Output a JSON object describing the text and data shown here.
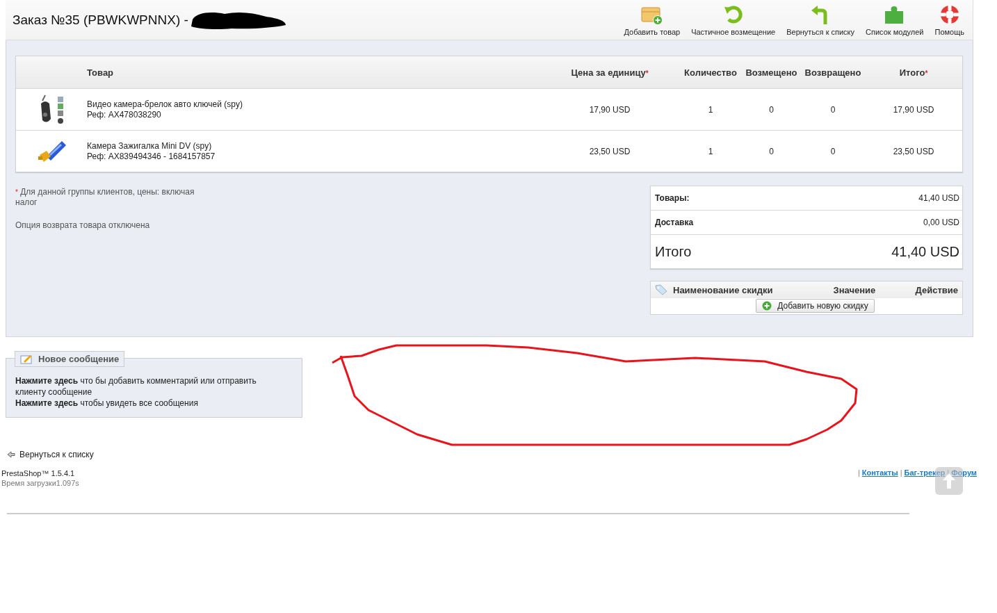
{
  "header": {
    "title": "Заказ №35 (PBWKWPNNX) -",
    "toolbar": [
      {
        "label": "Добавить товар",
        "kind": "add"
      },
      {
        "label": "Частичное возмещение",
        "kind": "refund"
      },
      {
        "label": "Вернуться к списку",
        "kind": "back"
      },
      {
        "label": "Список модулей",
        "kind": "modules"
      },
      {
        "label": "Помощь",
        "kind": "help"
      }
    ]
  },
  "products": {
    "columns": [
      {
        "label": "Товар"
      },
      {
        "label": "Цена за единицу",
        "mark": "*"
      },
      {
        "label": "Количество"
      },
      {
        "label": "Возмещено"
      },
      {
        "label": "Возвращено"
      },
      {
        "label": "Итого",
        "mark": "*"
      }
    ],
    "rows": [
      {
        "kind": "keyfob",
        "name": "Видео камера-брелок авто ключей (spy)",
        "ref": "Реф: AX478038290",
        "unit_price": "17,90 USD",
        "quantity": "1",
        "refunded": "0",
        "returned": "0",
        "total": "17,90 USD"
      },
      {
        "kind": "lighter",
        "name": "Камера Зажигалка Mini DV (spy)",
        "ref": "Реф: AX839494346 - 1684157857",
        "unit_price": "23,50 USD",
        "quantity": "1",
        "refunded": "0",
        "returned": "0",
        "total": "23,50 USD"
      }
    ]
  },
  "notes": {
    "mark": "*",
    "tax_note": "Для данной группы клиентов, цены: включая налог",
    "return_note": "Опция возврата товара отключена"
  },
  "summary": [
    {
      "label": "Товары:",
      "value": "41,40 USD",
      "kind": "line"
    },
    {
      "label": "Доставка",
      "value": "0,00 USD",
      "kind": "line"
    },
    {
      "label": "Итого",
      "value": "41,40 USD",
      "kind": "grand"
    }
  ],
  "discounts": {
    "columns": [
      "Наименование скидки",
      "Значение",
      "Действие"
    ],
    "add_button": "Добавить новую скидку"
  },
  "messages": {
    "legend": "Новое сообщение",
    "lines": [
      "**Нажмите здесь** что бы добавить комментарий или отправить клиенту сообщение",
      "**Нажмите здесь** чтобы увидеть все сообщения"
    ]
  },
  "back_link": "Вернуться к списку",
  "footer": {
    "version": "PrestaShop™ 1.5.4.1",
    "load_time": "Время загрузки1.097s",
    "separator": "|",
    "links": [
      "Контакты",
      "Баг-трекер",
      "Форум"
    ]
  }
}
